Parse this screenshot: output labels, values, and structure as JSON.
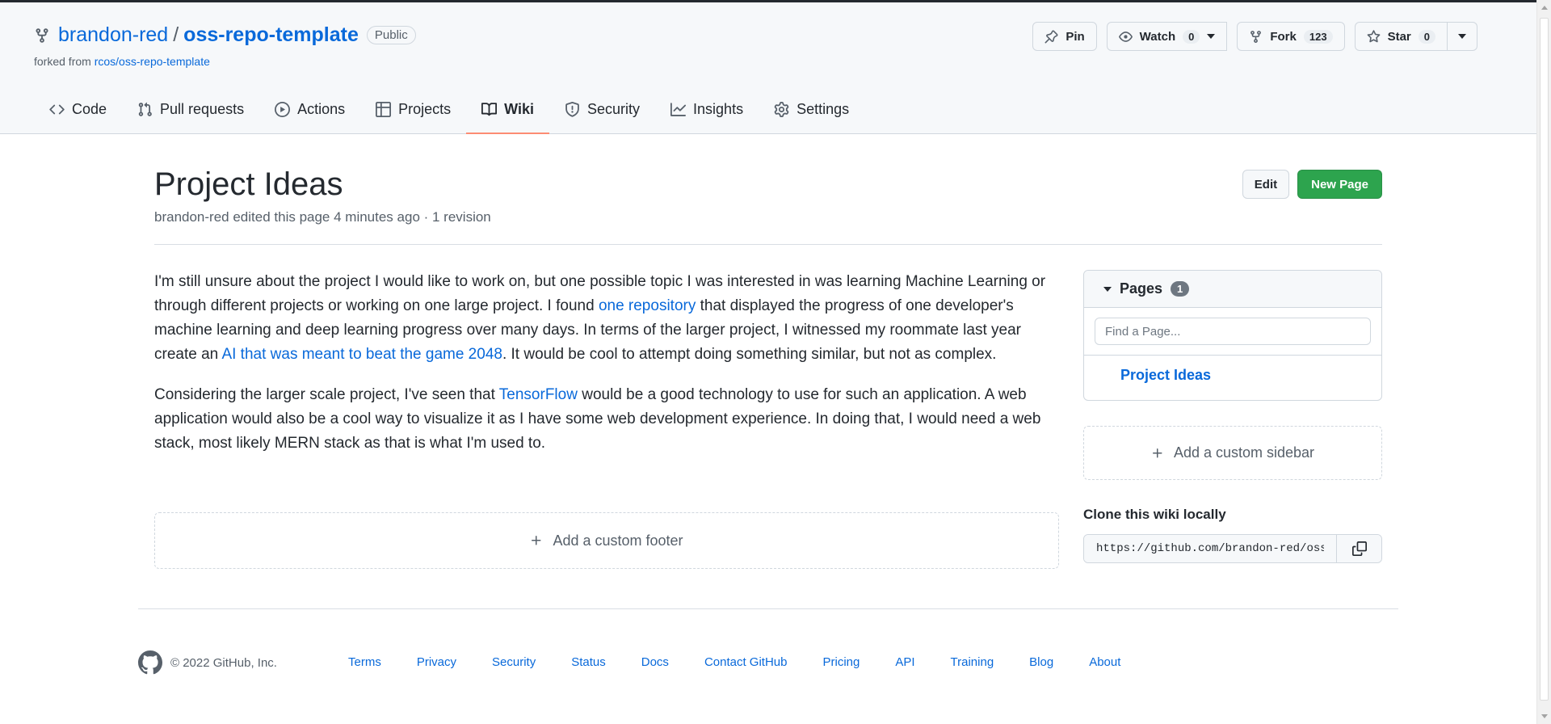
{
  "repo": {
    "owner": "brandon-red",
    "separator": "/",
    "name": "oss-repo-template",
    "visibility": "Public",
    "forked_prefix": "forked from",
    "forked_from": "rcos/oss-repo-template"
  },
  "actions": {
    "pin": "Pin",
    "watch": "Watch",
    "watch_count": "0",
    "fork": "Fork",
    "fork_count": "123",
    "star": "Star",
    "star_count": "0"
  },
  "tabs": [
    {
      "label": "Code",
      "icon": "code-icon"
    },
    {
      "label": "Pull requests",
      "icon": "pull-request-icon"
    },
    {
      "label": "Actions",
      "icon": "play-icon"
    },
    {
      "label": "Projects",
      "icon": "table-icon"
    },
    {
      "label": "Wiki",
      "icon": "book-icon",
      "selected": true
    },
    {
      "label": "Security",
      "icon": "shield-icon"
    },
    {
      "label": "Insights",
      "icon": "graph-icon"
    },
    {
      "label": "Settings",
      "icon": "gear-icon"
    }
  ],
  "wiki": {
    "title": "Project Ideas",
    "meta": "brandon-red edited this page 4 minutes ago · 1 revision",
    "edit_label": "Edit",
    "new_page_label": "New Page",
    "paragraphs": {
      "p1_a": "I'm still unsure about the project I would like to work on, but one possible topic I was interested in was learning Machine Learning or through different projects or working on one large project. I found ",
      "p1_link1": "one repository",
      "p1_b": " that displayed the progress of one developer's machine learning and deep learning progress over many days. In terms of the larger project, I witnessed my roommate last year create an ",
      "p1_link2": "AI that was meant to beat the game 2048",
      "p1_c": ". It would be cool to attempt doing something similar, but not as complex.",
      "p2_a": "Considering the larger scale project, I've seen that ",
      "p2_link": "TensorFlow",
      "p2_b": " would be a good technology to use for such an application. A web application would also be a cool way to visualize it as I have some web development experience. In doing that, I would need a web stack, most likely MERN stack as that is what I'm used to."
    },
    "add_footer": "Add a custom footer"
  },
  "sidebar": {
    "pages_label": "Pages",
    "pages_count": "1",
    "find_placeholder": "Find a Page...",
    "page_items": [
      "Project Ideas"
    ],
    "add_sidebar": "Add a custom sidebar",
    "clone_title": "Clone this wiki locally",
    "clone_url": "https://github.com/brandon-red/oss-repo-template.wiki.git"
  },
  "footer": {
    "copyright": "© 2022 GitHub, Inc.",
    "links": [
      "Terms",
      "Privacy",
      "Security",
      "Status",
      "Docs",
      "Contact GitHub",
      "Pricing",
      "API",
      "Training",
      "Blog",
      "About"
    ]
  }
}
